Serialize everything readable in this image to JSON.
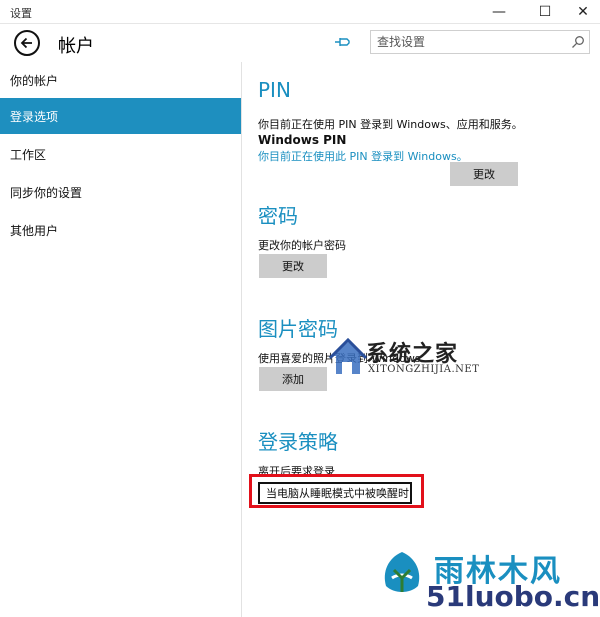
{
  "window": {
    "title": "设置",
    "minimize_glyph": "—",
    "maximize_glyph": "☐",
    "close_glyph": "✕"
  },
  "header": {
    "page_title": "帐户",
    "search_placeholder": "查找设置"
  },
  "sidebar": {
    "items": [
      {
        "label": "你的帐户",
        "active": false
      },
      {
        "label": "登录选项",
        "active": true
      },
      {
        "label": "工作区",
        "active": false
      },
      {
        "label": "同步你的设置",
        "active": false
      },
      {
        "label": "其他用户",
        "active": false
      }
    ]
  },
  "main": {
    "pin": {
      "title": "PIN",
      "description": "你目前正在使用 PIN 登录到 Windows、应用和服务。",
      "windows_pin_label": "Windows PIN",
      "windows_pin_link": "你目前正在使用此 PIN 登录到 Windows。",
      "change_button": "更改"
    },
    "password": {
      "title": "密码",
      "description": "更改你的帐户密码",
      "change_button": "更改"
    },
    "picture_password": {
      "title": "图片密码",
      "description": "使用喜爱的照片登录到 Windows",
      "add_button": "添加"
    },
    "sign_in_policy": {
      "title": "登录策略",
      "description": "离开后要求登录",
      "dropdown_value": "当电脑从睡眠模式中被唤醒时"
    }
  },
  "watermarks": {
    "xitong_name": "系统之家",
    "xitong_url": "XITONGZHIJIA.NET",
    "yulin_name": "雨林木风",
    "yulin_url": "51luobo.cn"
  },
  "colors": {
    "accent": "#1a8fc0",
    "sidebar_active": "#1e8fbf",
    "button": "#cccccc",
    "highlight": "#e2101a"
  }
}
